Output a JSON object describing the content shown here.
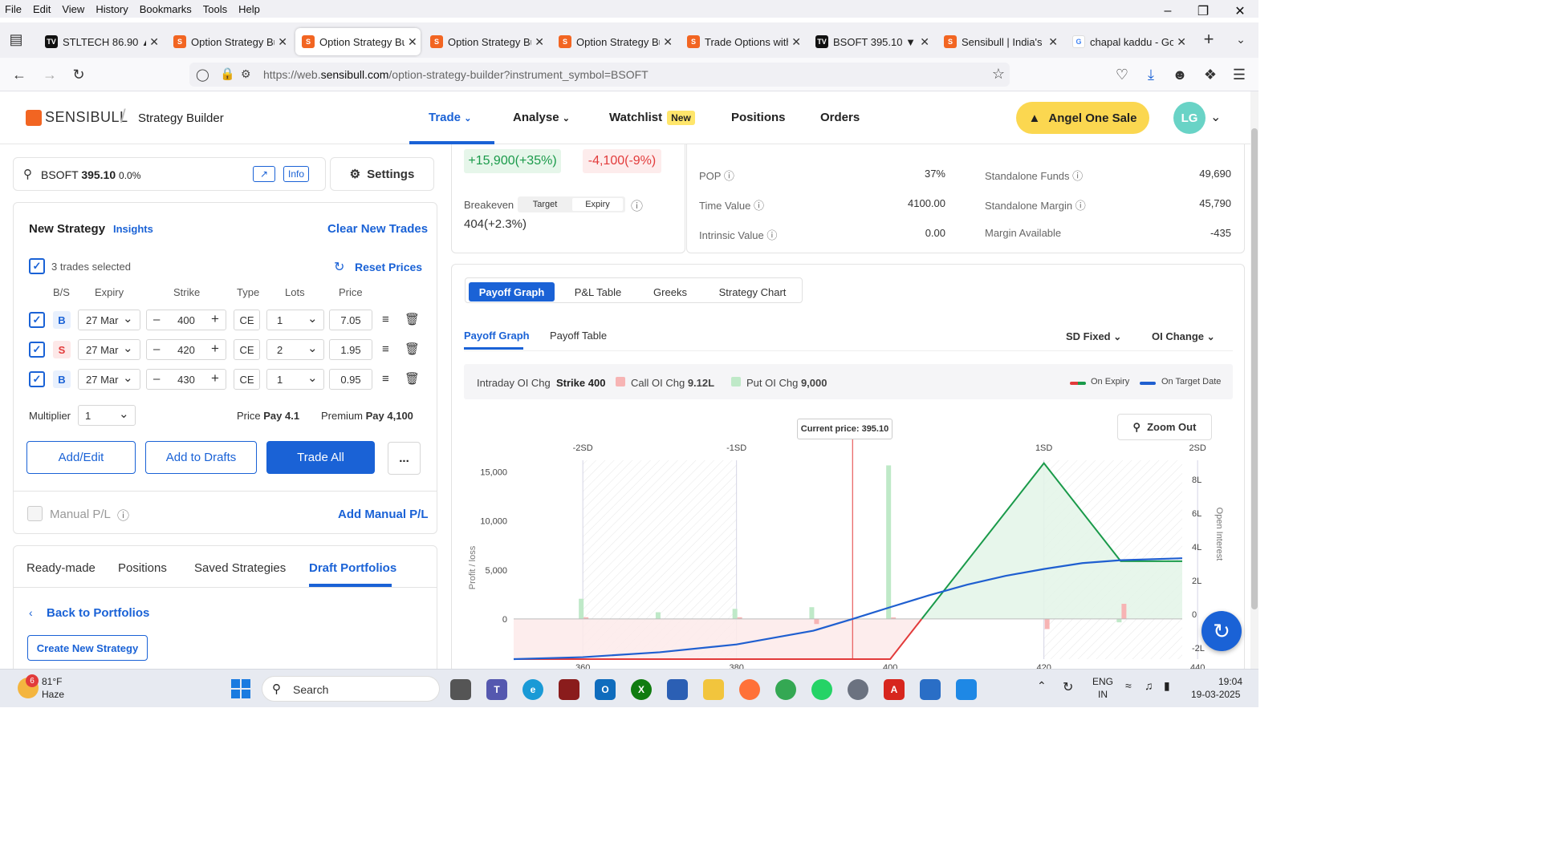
{
  "menubar": {
    "items": [
      "File",
      "Edit",
      "View",
      "History",
      "Bookmarks",
      "Tools",
      "Help"
    ]
  },
  "tabs": [
    {
      "label": "STLTECH 86.90 ▲ +",
      "active": false
    },
    {
      "label": "Option Strategy Bu",
      "active": false
    },
    {
      "label": "Option Strategy Bu",
      "active": true
    },
    {
      "label": "Option Strategy Bu",
      "active": false
    },
    {
      "label": "Option Strategy Bu",
      "active": false
    },
    {
      "label": "Trade Options with",
      "active": false
    },
    {
      "label": "BSOFT 395.10 ▼ −",
      "active": false
    },
    {
      "label": "Sensibull | India's fi",
      "active": false
    },
    {
      "label": "chapal kaddu - Go",
      "active": false
    }
  ],
  "url": {
    "prefix": "https://web.",
    "domain": "sensibull.com",
    "path": "/option-strategy-builder?instrument_symbol=BSOFT"
  },
  "header": {
    "logo": "SENSIBULL",
    "section": "Strategy Builder",
    "nav": [
      "Trade",
      "Analyse",
      "Watchlist",
      "Positions",
      "Orders"
    ],
    "new_badge": "New",
    "cta": "Angel One Sale",
    "avatar": "LG"
  },
  "search": {
    "symbol": "BSOFT",
    "price": "395.10",
    "change": "0.0%",
    "info": "Info",
    "settings": "Settings"
  },
  "strategy": {
    "title": "New Strategy",
    "insights": "Insights",
    "clear": "Clear New Trades",
    "selected": "3 trades selected",
    "reset": "Reset Prices",
    "columns": [
      "B/S",
      "Expiry",
      "Strike",
      "Type",
      "Lots",
      "Price"
    ],
    "rows": [
      {
        "side": "B",
        "expiry": "27 Mar",
        "strike": "400",
        "type": "CE",
        "lots": "1",
        "price": "7.05"
      },
      {
        "side": "S",
        "expiry": "27 Mar",
        "strike": "420",
        "type": "CE",
        "lots": "2",
        "price": "1.95"
      },
      {
        "side": "B",
        "expiry": "27 Mar",
        "strike": "430",
        "type": "CE",
        "lots": "1",
        "price": "0.95"
      }
    ],
    "multiplier_label": "Multiplier",
    "multiplier": "1",
    "price_label": "Price",
    "price_value": "Pay 4.1",
    "premium_label": "Premium",
    "premium_value": "Pay 4,100",
    "buttons": [
      "Add/Edit",
      "Add to Drafts",
      "Trade All",
      "..."
    ],
    "manual_pl": "Manual P/L",
    "add_manual": "Add Manual P/L"
  },
  "bottom_tabs": [
    "Ready-made",
    "Positions",
    "Saved Strategies",
    "Draft Portfolios"
  ],
  "back": "Back to Portfolios",
  "create": "Create New Strategy",
  "summary": {
    "max_profit": "+15,900(+35%)",
    "max_loss": "-4,100(-9%)",
    "breakeven_label": "Breakeven",
    "toggle": [
      "Target",
      "Expiry"
    ],
    "breakeven": "404(+2.3%)",
    "stats": [
      {
        "label": "POP",
        "value": "37%"
      },
      {
        "label": "Time Value",
        "value": "4100.00"
      },
      {
        "label": "Intrinsic Value",
        "value": "0.00"
      }
    ],
    "funds": [
      {
        "label": "Standalone Funds",
        "value": "49,690"
      },
      {
        "label": "Standalone Margin",
        "value": "45,790"
      },
      {
        "label": "Margin Available",
        "value": "-435"
      }
    ]
  },
  "graph_tabs": [
    "Payoff Graph",
    "P&L Table",
    "Greeks",
    "Strategy Chart"
  ],
  "sub_tabs": [
    "Payoff Graph",
    "Payoff Table"
  ],
  "dropdowns": [
    "SD Fixed",
    "OI Change"
  ],
  "oi_bar": {
    "label": "Intraday OI Chg",
    "strike": "Strike 400",
    "call_label": "Call OI Chg",
    "call_value": "9.12L",
    "put_label": "Put OI Chg",
    "put_value": "9,000",
    "legend": [
      "On Expiry",
      "On Target Date"
    ]
  },
  "colors": {
    "accent": "#1a62d6",
    "profit": "#1a9a4a",
    "loss": "#e23b3b",
    "brand": "#f26522",
    "target": "#1f5fd0"
  },
  "chart_data": {
    "type": "line",
    "current_price_label": "Current price: 395.10",
    "zoom": "Zoom Out",
    "ylabel": "Profit / loss",
    "y2label": "Open Interest",
    "sd_labels": [
      "-2SD",
      "-1SD",
      "1SD",
      "2SD"
    ],
    "sd_x": [
      360,
      380,
      420,
      440
    ],
    "yticks": [
      {
        "v": 15000,
        "label": "15,000"
      },
      {
        "v": 10000,
        "label": "10,000"
      },
      {
        "v": 5000,
        "label": "5,000"
      },
      {
        "v": 0,
        "label": "0"
      }
    ],
    "y2ticks": [
      "8L",
      "6L",
      "4L",
      "2L",
      "0",
      "-2L"
    ],
    "xticks": [
      {
        "v": 360,
        "label": "360"
      },
      {
        "v": 380,
        "label": "380"
      },
      {
        "v": 400,
        "label": "400"
      },
      {
        "v": 420,
        "label": "420"
      },
      {
        "v": 440,
        "label": "440"
      }
    ],
    "xlim": [
      351,
      438
    ],
    "ylim": [
      -4100,
      16200
    ],
    "current_price": 395.1,
    "series": [
      {
        "name": "On Expiry",
        "points": [
          [
            351,
            -4100
          ],
          [
            400,
            -4100
          ],
          [
            420,
            15900
          ],
          [
            430,
            5900
          ],
          [
            438,
            5900
          ]
        ]
      },
      {
        "name": "On Target Date",
        "points": [
          [
            351,
            -4100
          ],
          [
            360,
            -3900
          ],
          [
            370,
            -3400
          ],
          [
            380,
            -2600
          ],
          [
            390,
            -1200
          ],
          [
            395.1,
            0
          ],
          [
            400,
            1200
          ],
          [
            405,
            2400
          ],
          [
            410,
            3500
          ],
          [
            415,
            4400
          ],
          [
            420,
            5100
          ],
          [
            425,
            5700
          ],
          [
            430,
            6000
          ],
          [
            438,
            6200
          ]
        ]
      }
    ],
    "oi_bars": [
      {
        "strike": 360,
        "call": 1.2,
        "put": 0.1
      },
      {
        "strike": 370,
        "call": 0.4,
        "put": 0
      },
      {
        "strike": 380,
        "call": 0.6,
        "put": 0.1
      },
      {
        "strike": 390,
        "call": 0.7,
        "put": -0.3
      },
      {
        "strike": 400,
        "call": 9.12,
        "put": 0.09
      },
      {
        "strike": 420,
        "call": 0,
        "put": -0.6
      },
      {
        "strike": 430,
        "call": -0.2,
        "put": 0.9
      }
    ]
  },
  "taskbar": {
    "weather_temp": "81°F",
    "weather_desc": "Haze",
    "weather_badge": "6",
    "search": "Search",
    "lang1": "ENG",
    "lang2": "IN",
    "time": "19:04",
    "date": "19-03-2025"
  }
}
